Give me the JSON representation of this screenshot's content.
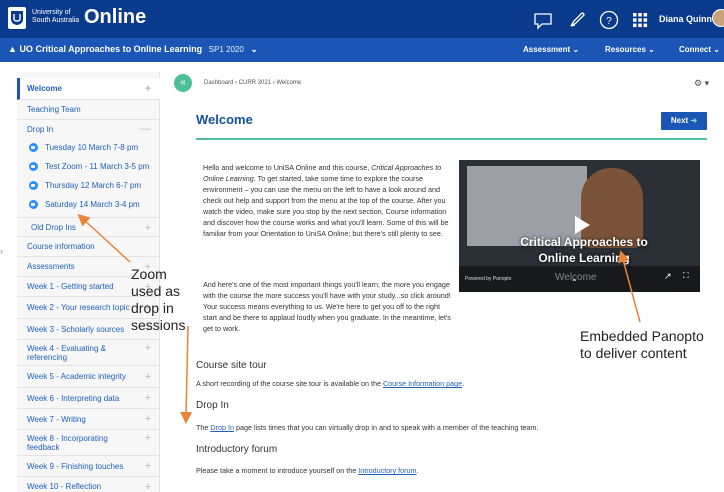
{
  "topbar": {
    "uni_line1": "University of",
    "uni_line2": "South Australia",
    "brand": "Online",
    "user": "Diana Quinn",
    "icons": [
      "chat-icon",
      "rocket-icon",
      "help-icon",
      "apps-grid-icon"
    ]
  },
  "coursebar": {
    "title": "UO Critical Approaches to Online Learning",
    "term": "SP1 2020",
    "menus": [
      "Assessment",
      "Resources",
      "Connect"
    ]
  },
  "breadcrumb": "Dashboard  ›  CURR 3021  ›  Welcome",
  "page_title": "Welcome",
  "next_label": "Next",
  "sidebar": {
    "items": [
      {
        "label": "Welcome",
        "sign": "+"
      },
      {
        "label": "Teaching Team",
        "sign": ""
      },
      {
        "label": "Drop In",
        "sign": "—"
      },
      {
        "label": "Old Drop Ins",
        "sign": "+"
      },
      {
        "label": "Course information",
        "sign": ""
      },
      {
        "label": "Assessments",
        "sign": "+"
      },
      {
        "label": "Week 1 - Getting started",
        "sign": "+"
      },
      {
        "label": "Week 2 - Your research topic",
        "sign": "+"
      },
      {
        "label": "Week 3 - Scholarly sources",
        "sign": "+"
      },
      {
        "label": "Week 4 - Evaluating & referencing",
        "sign": "+"
      },
      {
        "label": "Week 5 - Academic integrity",
        "sign": "+"
      },
      {
        "label": "Week 6 - Interpreting data",
        "sign": "+"
      },
      {
        "label": "Week 7 - Writing",
        "sign": "+"
      },
      {
        "label": "Week 8 - Incorporating feedback",
        "sign": "+"
      },
      {
        "label": "Week 9 - Finishing touches",
        "sign": "+"
      },
      {
        "label": "Week 10 - Reflection",
        "sign": "+"
      }
    ],
    "dropin_sessions": [
      "Tuesday 10 March 7-8 pm",
      "Test Zoom - 11 March 3-5 pm",
      "Thursday 12 March 6-7 pm",
      "Saturday 14 March 3-4 pm"
    ]
  },
  "content": {
    "intro": "Hello and welcome to UniSA Online and this course, Critical Approaches to Online Learning. To get started, take some time to explore the course environment – you can use the menu on the left to have a look around and check out help and support from the menu at the top of the course. After you watch the video, make sure you stop by the next section, Course information and discover how the course works and what you'll learn. Some of this will be familiar from your Orientation to UniSA Online; but there's still plenty to see.",
    "intro_italic": "Critical Approaches to Online Learning",
    "para2": "And here's one of the most important things you'll learn; the more you engage with the course the more success you'll have with your study...so click around! Your success means everything to us. We're here to get you off to the right start and be there to applaud loudly when you graduate. In the meantime, let's get to work.",
    "tour_heading": "Course site tour",
    "tour_text_pre": "A short recording of the course site tour is available on the ",
    "tour_link": "Course Information page",
    "tour_text_post": ".",
    "dropin_heading": "Drop In",
    "dropin_pre": "The ",
    "dropin_link": "Drop In",
    "dropin_post": " page lists times that you can virtually drop in and to speak with a member of the teaching team.",
    "forum_heading": "Introductory forum",
    "forum_pre": "Please take a moment to introduce yourself on the ",
    "forum_link": "Introductory forum",
    "forum_post": "."
  },
  "video": {
    "overlay_line1": "Critical Approaches to",
    "overlay_line2": "Online Learning",
    "powered": "Powered by Panopto",
    "title": "Welcome"
  },
  "annotations": {
    "zoom": [
      "Zoom",
      "used as",
      "drop in",
      "sessions"
    ],
    "panopto": [
      "Embedded Panopto",
      "to deliver content"
    ]
  },
  "colors": {
    "topbar": "#0a3a8c",
    "coursebar": "#1b55b6",
    "accent_green": "#4fbf9a",
    "link": "#1f5fbf",
    "arrow": "#e8833a"
  }
}
